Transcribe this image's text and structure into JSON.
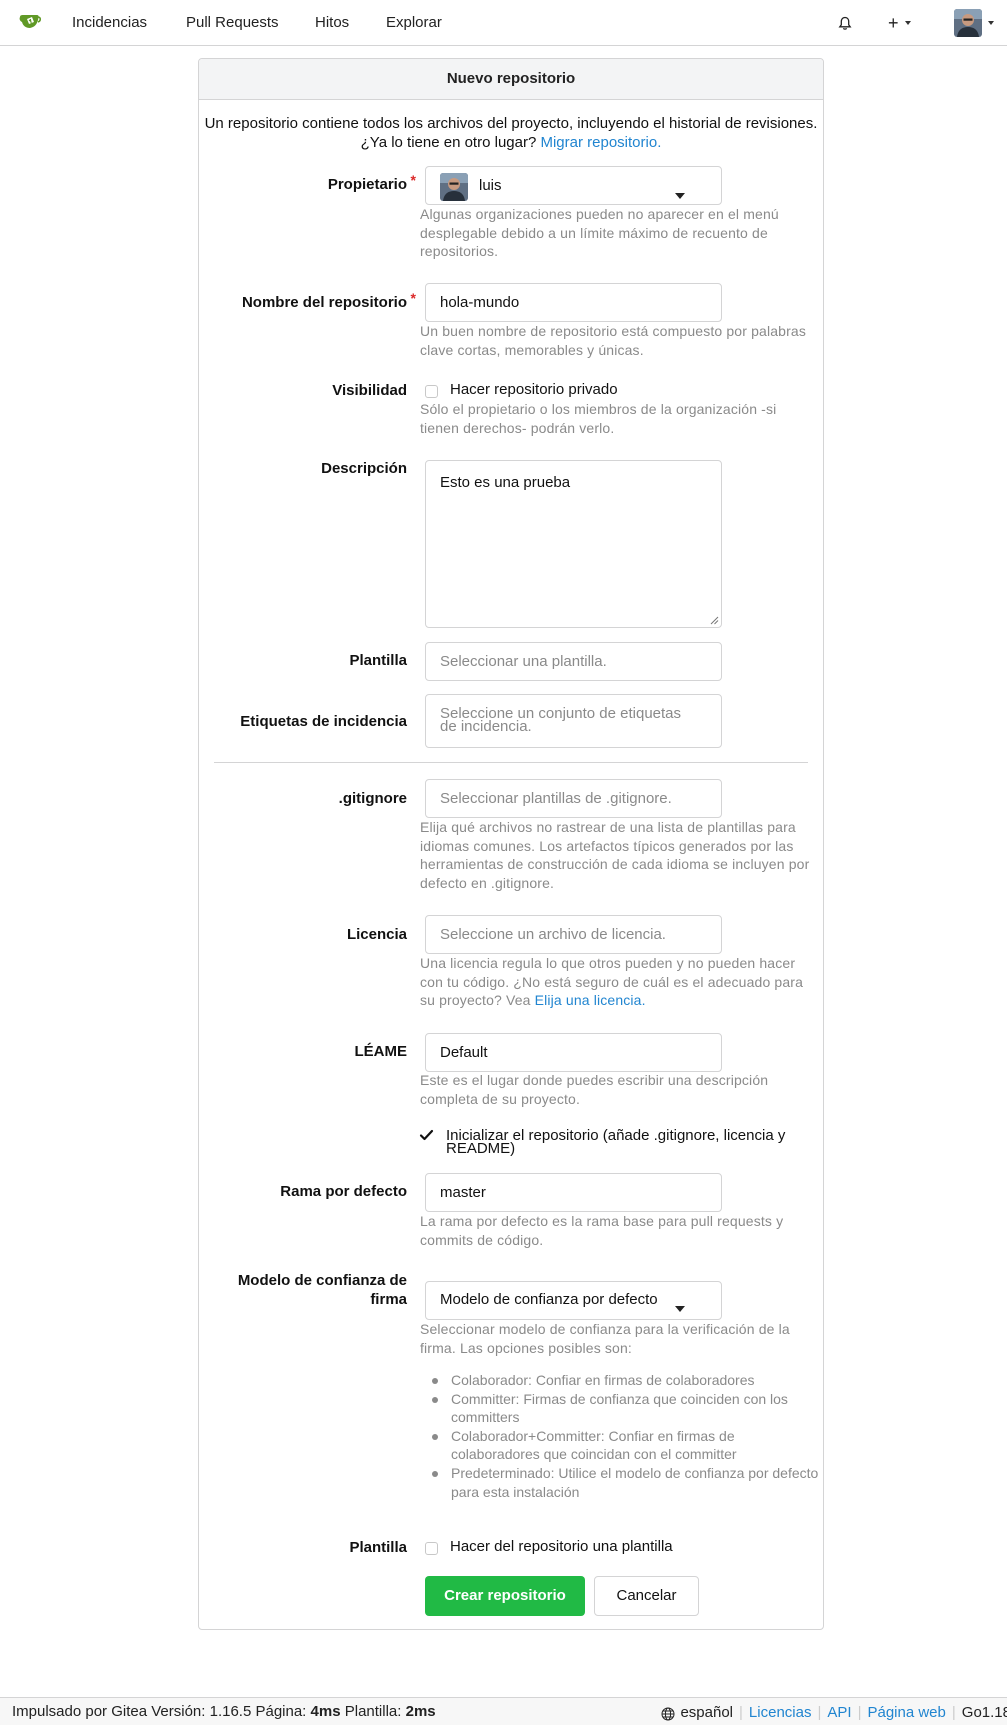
{
  "nav": {
    "items": [
      "Incidencias",
      "Pull Requests",
      "Hitos",
      "Explorar"
    ],
    "plus_label": "+"
  },
  "form": {
    "title": "Nuevo repositorio",
    "intro": "Un repositorio contiene todos los archivos del proyecto, incluyendo el historial de revisiones. ¿Ya lo tiene en otro lugar?",
    "intro_link": "Migrar repositorio.",
    "owner": {
      "label": "Propietario",
      "value": "luis",
      "help": "Algunas organizaciones pueden no aparecer en el menú desplegable debido a un límite máximo de recuento de repositorios."
    },
    "repo_name": {
      "label": "Nombre del repositorio",
      "value": "hola-mundo",
      "help": "Un buen nombre de repositorio está compuesto por palabras clave cortas, memorables y únicas."
    },
    "visibility": {
      "label": "Visibilidad",
      "checkbox_label": "Hacer repositorio privado",
      "checked": false,
      "help": "Sólo el propietario o los miembros de la organización -si tienen derechos- podrán verlo."
    },
    "description": {
      "label": "Descripción",
      "value": "Esto es una prueba"
    },
    "template": {
      "label": "Plantilla",
      "placeholder": "Seleccionar una plantilla."
    },
    "issue_labels": {
      "label": "Etiquetas de incidencia",
      "placeholder": "Seleccione un conjunto de etiquetas de incidencia."
    },
    "gitignore": {
      "label": ".gitignore",
      "placeholder": "Seleccionar plantillas de .gitignore.",
      "help": "Elija qué archivos no rastrear de una lista de plantillas para idiomas comunes. Los artefactos típicos generados por las herramientas de construcción de cada idioma se incluyen por defecto en .gitignore."
    },
    "license": {
      "label": "Licencia",
      "placeholder": "Seleccione un archivo de licencia.",
      "help": "Una licencia regula lo que otros pueden y no pueden hacer con tu código. ¿No está seguro de cuál es el adecuado para su proyecto? Vea",
      "help_link": "Elija una licencia."
    },
    "readme": {
      "label": "LÉAME",
      "value": "Default",
      "help": "Este es el lugar donde puedes escribir una descripción completa de su proyecto."
    },
    "auto_init": {
      "label": "Inicializar el repositorio (añade .gitignore, licencia y README)",
      "checked": true
    },
    "default_branch": {
      "label": "Rama por defecto",
      "value": "master",
      "help": "La rama por defecto es la rama base para pull requests y commits de código."
    },
    "trust_model": {
      "label": "Modelo de confianza de firma",
      "value": "Modelo de confianza por defecto",
      "help": "Seleccionar modelo de confianza para la verificación de la firma. Las opciones posibles son:",
      "options": [
        "Colaborador: Confiar en firmas de colaboradores",
        "Committer: Firmas de confianza que coinciden con los committers",
        "Colaborador+Committer: Confiar en firmas de colaboradores que coincidan con el committer",
        "Predeterminado: Utilice el modelo de confianza por defecto para esta instalación"
      ]
    },
    "template_flag": {
      "label": "Plantilla",
      "checkbox_label": "Hacer del repositorio una plantilla",
      "checked": false
    },
    "submit_label": "Crear repositorio",
    "cancel_label": "Cancelar"
  },
  "footer": {
    "powered": "Impulsado por Gitea Versión: 1.16.5 Página:",
    "page_time": "4ms",
    "template_text": "Plantilla:",
    "template_time": "2ms",
    "language": "español",
    "links": [
      "Licencias",
      "API",
      "Página web"
    ],
    "go_version": "Go1.18"
  },
  "colors": {
    "primary_button": "#21ba45",
    "link": "#2185d0",
    "required": "#db2828"
  }
}
